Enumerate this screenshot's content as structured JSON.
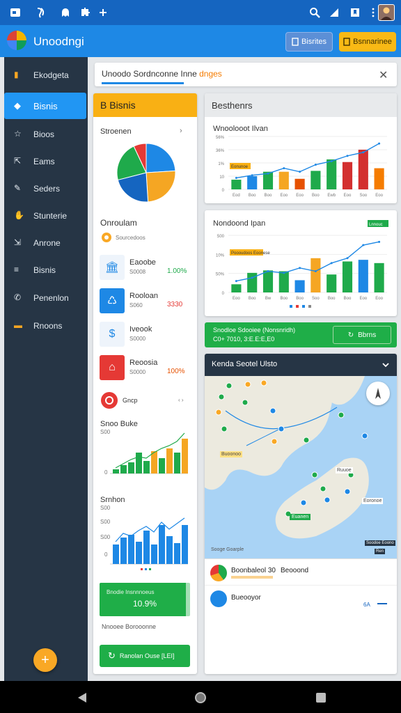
{
  "app": {
    "title": "Unoodngi"
  },
  "topbar": {
    "business_label": "Bisrites",
    "banner_label": "Bsnnarinee"
  },
  "sidebar": {
    "items": [
      {
        "label": "Ekodgeta",
        "icon": "bar-chart-icon"
      },
      {
        "label": "Bisnis",
        "icon": "analytics-icon",
        "active": true
      },
      {
        "label": "Bioos",
        "icon": "star-icon"
      },
      {
        "label": "Eams",
        "icon": "share-icon"
      },
      {
        "label": "Seders",
        "icon": "edit-icon"
      },
      {
        "label": "Stunterie",
        "icon": "handshake-icon"
      },
      {
        "label": "Anrone",
        "icon": "export-icon"
      },
      {
        "label": "Bisnis",
        "icon": "list-icon"
      },
      {
        "label": "Penenlon",
        "icon": "phone-icon"
      },
      {
        "label": "Rnoons",
        "icon": "folder-icon"
      }
    ]
  },
  "search": {
    "text": "Unoodo Sordnconne Inne ",
    "highlight": "dnges"
  },
  "left_panel": {
    "title": "B Bisnis",
    "pie_title": "Stroenen",
    "pie": {
      "slices": [
        {
          "value": 24,
          "color": "#1e88e5"
        },
        {
          "value": 25,
          "color": "#f5a623"
        },
        {
          "value": 22,
          "color": "#1565c0"
        },
        {
          "value": 22,
          "color": "#1faa4b"
        },
        {
          "value": 7,
          "color": "#e53935"
        }
      ]
    },
    "section_title": "Onroulam",
    "subrow": "Sourcedoos",
    "rows": [
      {
        "label": "Eaoobe",
        "sub": "S0008",
        "value": "1.00%",
        "value_color": "#1faa4b",
        "icon_bg": "#eef4fb",
        "icon": "bank-icon"
      },
      {
        "label": "Rooloan",
        "sub": "S060",
        "value": "3330",
        "value_color": "#e53935",
        "icon_bg": "#1e88e5",
        "icon": "loan-icon"
      },
      {
        "label": "Iveook",
        "sub": "S0000",
        "value": "",
        "value_color": "#333",
        "icon_bg": "#eef4fb",
        "icon": "dollar-icon"
      },
      {
        "label": "Reoosia",
        "sub": "S0000",
        "value": "100%",
        "value_color": "#e65100",
        "icon_bg": "#e53935",
        "icon": "building-icon"
      }
    ],
    "badge_text": "Gncp",
    "badge_arrows": "‹ ›",
    "chart1": {
      "title": "Snoo Buke",
      "ytick_top": "S00",
      "ytick_zero": "0"
    },
    "chart2": {
      "title": "Srnhon",
      "ytick_top": "S00",
      "ytick_mid": "S00",
      "ytick_low": "S00",
      "ytick_zero": "0"
    },
    "green_box": {
      "top": "Bnodie Insnnnoeus",
      "value": "10.9%"
    },
    "footer_label": "Nnooee Borooonne",
    "cta_label": "Ranolan Ouse [LEI]"
  },
  "chart_data": [
    {
      "type": "bar",
      "title": "Wnoolooot Ilvan",
      "categories": [
        "Eod",
        "Boo",
        "Boo",
        "Eoo",
        "Eoo",
        "Boo",
        "Ewb",
        "Eoo",
        "Soo",
        "Eoo"
      ],
      "series": [
        {
          "values": [
            11,
            15,
            20,
            20,
            12,
            21,
            34,
            31,
            45,
            24
          ]
        }
      ],
      "bar_colors": [
        "#1faa4b",
        "#1e88e5",
        "#1faa4b",
        "#f5a623",
        "#e65100",
        "#1faa4b",
        "#1faa4b",
        "#d32f2f",
        "#d32f2f",
        "#f57c00"
      ],
      "line": [
        13,
        16,
        18,
        24,
        20,
        28,
        32,
        38,
        42,
        52
      ],
      "yticks": [
        "56%",
        "36%",
        "1%",
        "10",
        "0"
      ],
      "legend": "Eonunoe",
      "ylim": [
        0,
        60
      ]
    },
    {
      "type": "bar",
      "title": "Nondoond Ipan",
      "categories": [
        "Eoo",
        "Boo",
        "Bw",
        "Boo",
        "Boo",
        "Soo",
        "Boo",
        "Boo",
        "Eoo",
        "Eoo"
      ],
      "series": [
        {
          "values": [
            10,
            24,
            27,
            26,
            15,
            42,
            22,
            38,
            40,
            36
          ]
        }
      ],
      "bar_colors": [
        "#1faa4b",
        "#1faa4b",
        "#1faa4b",
        "#1faa4b",
        "#1e88e5",
        "#f5a623",
        "#1faa4b",
        "#1faa4b",
        "#1e88e5",
        "#1faa4b"
      ],
      "line": [
        14,
        18,
        26,
        24,
        30,
        26,
        36,
        42,
        58,
        62
      ],
      "yticks": [
        "S00",
        "10%",
        "S0%",
        "0"
      ],
      "legend": "Poooudoos Eoonese",
      "badge": "Lnnouc",
      "ylim": [
        0,
        70
      ]
    }
  ],
  "banner": {
    "line1": "Snodloe Sdooiee (Nonsnridh)",
    "line2": "C0+ 7010, 3:E.E:E,E0",
    "button": "Bbrns"
  },
  "map": {
    "title": "Kenda Seotel Ulsto",
    "attribution": "Sooge Goarple",
    "tag": "Euanen",
    "tag2": "Ruuoe",
    "tag3": "Buoonoo",
    "tag4": "Eoronoe",
    "scale": "Soodoe Eoono",
    "scale2": "Ren"
  },
  "map_list": [
    {
      "label": "Boonbaleol 30",
      "extra": "Beooond"
    },
    {
      "label": "Bueooyor",
      "extra": "6A"
    }
  ]
}
